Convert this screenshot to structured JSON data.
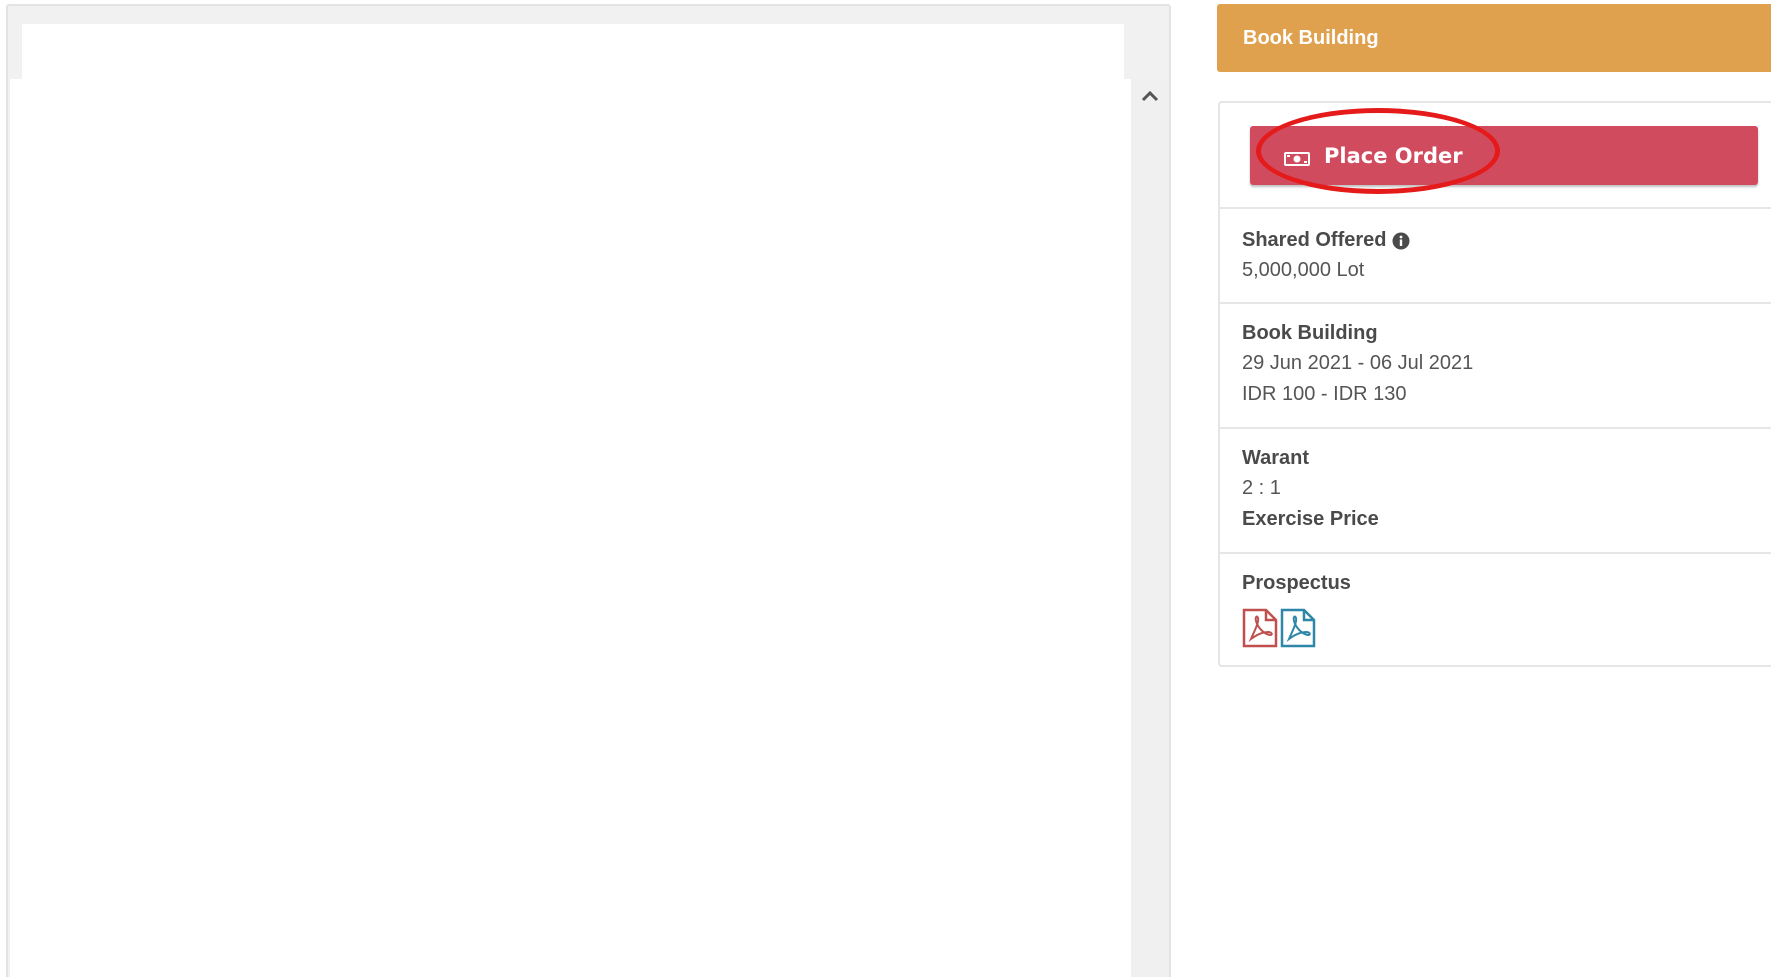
{
  "viewer": {
    "scroll_up_icon": "chevron-up-icon"
  },
  "side_panel": {
    "header_title": "Book Building",
    "place_order": {
      "label": "Place Order",
      "icon": "money-icon",
      "color": "#d14b5f"
    },
    "header_color": "#e0a14f",
    "sections": {
      "shares_offered": {
        "label": "Shared Offered",
        "icon": "info-icon",
        "value": "5,000,000 Lot"
      },
      "book_building": {
        "label": "Book Building",
        "period": "29 Jun 2021 - 06 Jul 2021",
        "price_range": "IDR 100 - IDR 130"
      },
      "warant": {
        "label": "Warant",
        "ratio": "2 : 1",
        "exercise_label": "Exercise Price"
      },
      "prospectus": {
        "label": "Prospectus",
        "files": [
          {
            "icon": "pdf-icon",
            "color": "#c0504d"
          },
          {
            "icon": "pdf-icon",
            "color": "#2e86a8"
          }
        ]
      }
    }
  }
}
